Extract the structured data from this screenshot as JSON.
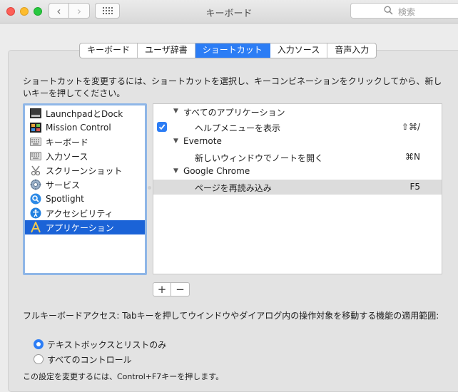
{
  "window": {
    "title": "キーボード"
  },
  "search": {
    "placeholder": "検索"
  },
  "tabs": [
    {
      "label": "キーボード",
      "active": false
    },
    {
      "label": "ユーザ辞書",
      "active": false
    },
    {
      "label": "ショートカット",
      "active": true
    },
    {
      "label": "入力ソース",
      "active": false
    },
    {
      "label": "音声入力",
      "active": false
    }
  ],
  "description": "ショートカットを変更するには、ショートカットを選択し、キーコンビネーションをクリックしてから、新しいキーを押してください。",
  "categories": [
    {
      "label": "LaunchpadとDock",
      "icon": "launchpad-dock-icon"
    },
    {
      "label": "Mission Control",
      "icon": "mission-control-icon"
    },
    {
      "label": "キーボード",
      "icon": "keyboard-icon"
    },
    {
      "label": "入力ソース",
      "icon": "input-source-icon"
    },
    {
      "label": "スクリーンショット",
      "icon": "screenshot-icon"
    },
    {
      "label": "サービス",
      "icon": "gear-icon"
    },
    {
      "label": "Spotlight",
      "icon": "spotlight-icon"
    },
    {
      "label": "アクセシビリティ",
      "icon": "accessibility-icon"
    },
    {
      "label": "アプリケーション",
      "icon": "applications-icon",
      "selected": true
    }
  ],
  "shortcuts": {
    "all_apps_group": "すべてのアプリケーション",
    "help_menu": {
      "label": "ヘルプメニューを表示",
      "key": "⇧⌘/",
      "checked": true
    },
    "evernote_group": "Evernote",
    "new_note": {
      "label": "新しいウィンドウでノートを開く",
      "key": "⌘N"
    },
    "chrome_group": "Google Chrome",
    "reload": {
      "label": "ページを再読み込み",
      "key": "F5"
    }
  },
  "buttons": {
    "add": "+",
    "remove": "−"
  },
  "full_keyboard_access": {
    "label": "フルキーボードアクセス: Tabキーを押してウインドウやダイアログ内の操作対象を移動する機能の適用範囲:",
    "options": [
      {
        "label": "テキストボックスとリストのみ",
        "selected": true
      },
      {
        "label": "すべてのコントロール",
        "selected": false
      }
    ]
  },
  "footer_note": "この設定を変更するには、Control+F7キーを押します。",
  "colors": {
    "accent": "#2c7df5",
    "selection": "#1b63d7",
    "list_focus_border": "#8fb6e7"
  }
}
